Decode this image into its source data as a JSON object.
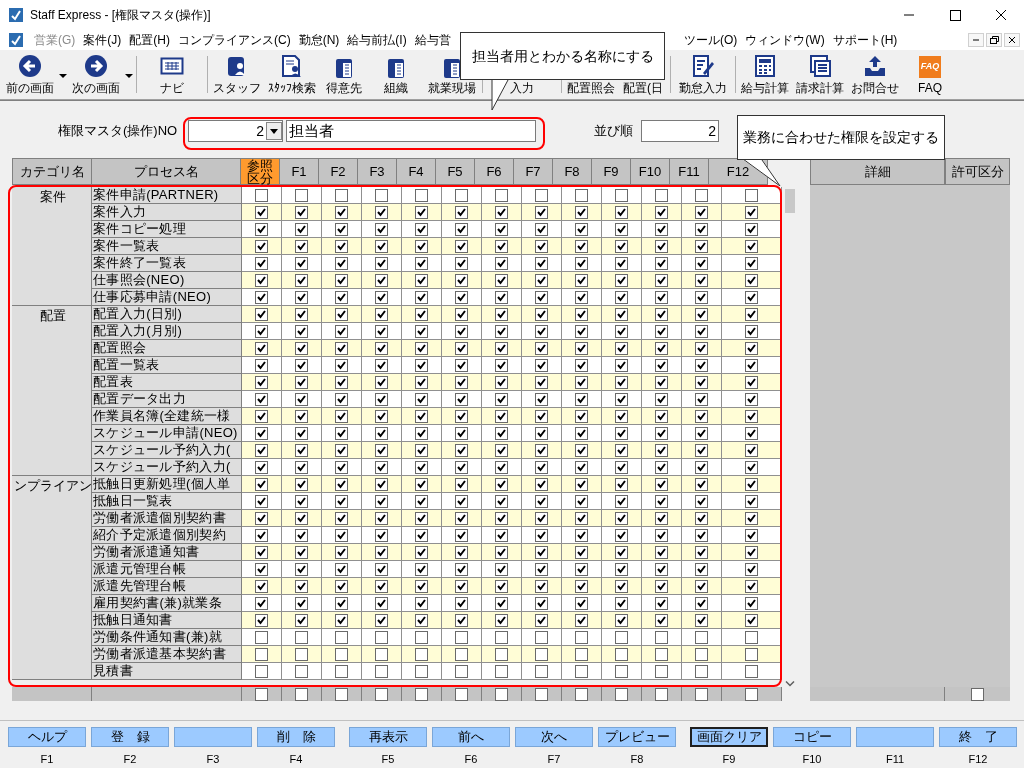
{
  "window": {
    "title": "Staff Express - [権限マスタ(操作)]"
  },
  "menu": [
    {
      "label": "営業(G)",
      "disabled": true
    },
    {
      "label": "案件(J)",
      "disabled": false
    },
    {
      "label": "配置(H)",
      "disabled": false
    },
    {
      "label": "コンプライアンス(C)",
      "disabled": false
    },
    {
      "label": "勤怠(N)",
      "disabled": false
    },
    {
      "label": "給与前払(I)",
      "disabled": false
    },
    {
      "label": "給与営",
      "disabled": false
    },
    {
      "label": "ツール(O)",
      "disabled": false
    },
    {
      "label": "ウィンドウ(W)",
      "disabled": false
    },
    {
      "label": "サポート(H)",
      "disabled": false
    }
  ],
  "toolbar": [
    {
      "label": "前の画面",
      "kind": "back",
      "dropdown": true
    },
    {
      "label": "次の画面",
      "kind": "forward",
      "dropdown": true
    },
    {
      "label": "ナビ",
      "kind": "keyboard",
      "dropdown": false
    },
    {
      "label": "スタッフ",
      "kind": "person",
      "dropdown": false
    },
    {
      "label": "ｽﾀｯﾌ検索",
      "kind": "search",
      "dropdown": false
    },
    {
      "label": "得意先",
      "kind": "building",
      "dropdown": false
    },
    {
      "label": "組織",
      "kind": "building",
      "dropdown": false
    },
    {
      "label": "就業現場",
      "kind": "building",
      "dropdown": false
    },
    {
      "label": "入力",
      "kind": "plain",
      "dropdown": false
    },
    {
      "label": "配置照会",
      "kind": "plain",
      "dropdown": false
    },
    {
      "label": "配置(日",
      "kind": "plain",
      "dropdown": false
    },
    {
      "label": "勤怠入力",
      "kind": "edit",
      "dropdown": false
    },
    {
      "label": "給与計算",
      "kind": "calc",
      "dropdown": false
    },
    {
      "label": "請求計算",
      "kind": "sheet",
      "dropdown": false
    },
    {
      "label": "お問合せ",
      "kind": "tray",
      "dropdown": false
    },
    {
      "label": "FAQ",
      "kind": "faq",
      "badge": "FAQ",
      "dropdown": false
    }
  ],
  "callouts": [
    {
      "text": "担当者用とわかる名称にする"
    },
    {
      "text": "業務に合わせた権限を設定する"
    }
  ],
  "form": {
    "no_label": "権限マスタ(操作)NO",
    "no_value": "2",
    "name_value": "担当者",
    "order_label": "並び順",
    "order_value": "2"
  },
  "table": {
    "columns": [
      {
        "label": "カテゴリ名",
        "highlighted": false
      },
      {
        "label": "プロセス名",
        "highlighted": false
      },
      {
        "label": "参照区分",
        "highlighted": true
      },
      {
        "label": "F1",
        "highlighted": false
      },
      {
        "label": "F2",
        "highlighted": false
      },
      {
        "label": "F3",
        "highlighted": false
      },
      {
        "label": "F4",
        "highlighted": false
      },
      {
        "label": "F5",
        "highlighted": false
      },
      {
        "label": "F6",
        "highlighted": false
      },
      {
        "label": "F7",
        "highlighted": false
      },
      {
        "label": "F8",
        "highlighted": false
      },
      {
        "label": "F9",
        "highlighted": false
      },
      {
        "label": "F10",
        "highlighted": false
      },
      {
        "label": "F11",
        "highlighted": false
      },
      {
        "label": "F12",
        "highlighted": false
      }
    ],
    "categories": [
      {
        "name": "案件",
        "processes": [
          {
            "name": "案件申請(PARTNER)",
            "checks": [
              false,
              false,
              false,
              false,
              false,
              false,
              false,
              false,
              false,
              false,
              false,
              false,
              false
            ]
          },
          {
            "name": "案件入力",
            "checks": [
              true,
              true,
              true,
              true,
              true,
              true,
              true,
              true,
              true,
              true,
              true,
              true,
              true
            ]
          },
          {
            "name": "案件コピー処理",
            "checks": [
              true,
              true,
              true,
              true,
              true,
              true,
              true,
              true,
              true,
              true,
              true,
              true,
              true
            ]
          },
          {
            "name": "案件一覧表",
            "checks": [
              true,
              true,
              true,
              true,
              true,
              true,
              true,
              true,
              true,
              true,
              true,
              true,
              true
            ]
          },
          {
            "name": "案件終了一覧表",
            "checks": [
              true,
              true,
              true,
              true,
              true,
              true,
              true,
              true,
              true,
              true,
              true,
              true,
              true
            ]
          },
          {
            "name": "仕事照会(NEO)",
            "checks": [
              true,
              true,
              true,
              true,
              true,
              true,
              true,
              true,
              true,
              true,
              true,
              true,
              true
            ]
          },
          {
            "name": "仕事応募申請(NEO)",
            "checks": [
              true,
              true,
              true,
              true,
              true,
              true,
              true,
              true,
              true,
              true,
              true,
              true,
              true
            ]
          }
        ]
      },
      {
        "name": "配置",
        "processes": [
          {
            "name": "配置入力(日別)",
            "checks": [
              true,
              true,
              true,
              true,
              true,
              true,
              true,
              true,
              true,
              true,
              true,
              true,
              true
            ]
          },
          {
            "name": "配置入力(月別)",
            "checks": [
              true,
              true,
              true,
              true,
              true,
              true,
              true,
              true,
              true,
              true,
              true,
              true,
              true
            ]
          },
          {
            "name": "配置照会",
            "checks": [
              true,
              true,
              true,
              true,
              true,
              true,
              true,
              true,
              true,
              true,
              true,
              true,
              true
            ]
          },
          {
            "name": "配置一覧表",
            "checks": [
              true,
              true,
              true,
              true,
              true,
              true,
              true,
              true,
              true,
              true,
              true,
              true,
              true
            ]
          },
          {
            "name": "配置表",
            "checks": [
              true,
              true,
              true,
              true,
              true,
              true,
              true,
              true,
              true,
              true,
              true,
              true,
              true
            ]
          },
          {
            "name": "配置データ出力",
            "checks": [
              true,
              true,
              true,
              true,
              true,
              true,
              true,
              true,
              true,
              true,
              true,
              true,
              true
            ]
          },
          {
            "name": "作業員名簿(全建統一様",
            "checks": [
              true,
              true,
              true,
              true,
              true,
              true,
              true,
              true,
              true,
              true,
              true,
              true,
              true
            ]
          },
          {
            "name": "スケジュール申請(NEO)",
            "checks": [
              true,
              true,
              true,
              true,
              true,
              true,
              true,
              true,
              true,
              true,
              true,
              true,
              true
            ]
          },
          {
            "name": "スケジュール予約入力(",
            "checks": [
              true,
              true,
              true,
              true,
              true,
              true,
              true,
              true,
              true,
              true,
              true,
              true,
              true
            ]
          },
          {
            "name": "スケジュール予約入力(",
            "checks": [
              true,
              true,
              true,
              true,
              true,
              true,
              true,
              true,
              true,
              true,
              true,
              true,
              true
            ]
          }
        ]
      },
      {
        "name": "ンプライアン",
        "processes": [
          {
            "name": "抵触日更新処理(個人単",
            "checks": [
              true,
              true,
              true,
              true,
              true,
              true,
              true,
              true,
              true,
              true,
              true,
              true,
              true
            ]
          },
          {
            "name": "抵触日一覧表",
            "checks": [
              true,
              true,
              true,
              true,
              true,
              true,
              true,
              true,
              true,
              true,
              true,
              true,
              true
            ]
          },
          {
            "name": "労働者派遣個別契約書",
            "checks": [
              true,
              true,
              true,
              true,
              true,
              true,
              true,
              true,
              true,
              true,
              true,
              true,
              true
            ]
          },
          {
            "name": "紹介予定派遣個別契約",
            "checks": [
              true,
              true,
              true,
              true,
              true,
              true,
              true,
              true,
              true,
              true,
              true,
              true,
              true
            ]
          },
          {
            "name": "労働者派遣通知書",
            "checks": [
              true,
              true,
              true,
              true,
              true,
              true,
              true,
              true,
              true,
              true,
              true,
              true,
              true
            ]
          },
          {
            "name": "派遣元管理台帳",
            "checks": [
              true,
              true,
              true,
              true,
              true,
              true,
              true,
              true,
              true,
              true,
              true,
              true,
              true
            ]
          },
          {
            "name": "派遣先管理台帳",
            "checks": [
              true,
              true,
              true,
              true,
              true,
              true,
              true,
              true,
              true,
              true,
              true,
              true,
              true
            ]
          },
          {
            "name": "雇用契約書(兼)就業条",
            "checks": [
              true,
              true,
              true,
              true,
              true,
              true,
              true,
              true,
              true,
              true,
              true,
              true,
              true
            ]
          },
          {
            "name": "抵触日通知書",
            "checks": [
              true,
              true,
              true,
              true,
              true,
              true,
              true,
              true,
              true,
              true,
              true,
              true,
              true
            ]
          },
          {
            "name": "労働条件通知書(兼)就",
            "checks": [
              false,
              false,
              false,
              false,
              false,
              false,
              false,
              false,
              false,
              false,
              false,
              false,
              false
            ]
          },
          {
            "name": "労働者派遣基本契約書",
            "checks": [
              false,
              false,
              false,
              false,
              false,
              false,
              false,
              false,
              false,
              false,
              false,
              false,
              false
            ]
          },
          {
            "name": "見積書",
            "checks": [
              false,
              false,
              false,
              false,
              false,
              false,
              false,
              false,
              false,
              false,
              false,
              false,
              false
            ]
          }
        ]
      }
    ],
    "footer_checks": [
      false,
      false,
      false,
      false,
      false,
      false,
      false,
      false,
      false,
      false,
      false,
      false,
      false
    ]
  },
  "detail_panel": {
    "columns": [
      "詳細",
      "許可区分"
    ],
    "footer_check": false
  },
  "function_keys": [
    {
      "label": "ヘルプ",
      "key": "F1",
      "selected": false
    },
    {
      "label": "登　録",
      "key": "F2",
      "selected": false
    },
    {
      "key": "F3",
      "selected": false
    },
    {
      "label": "削　除",
      "key": "F4",
      "selected": false
    },
    {
      "label": "再表示",
      "key": "F5",
      "selected": false
    },
    {
      "label": "前へ",
      "key": "F6",
      "selected": false
    },
    {
      "label": "次へ",
      "key": "F7",
      "selected": false
    },
    {
      "label": "プレビュー",
      "key": "F8",
      "selected": false
    },
    {
      "label": "画面クリア",
      "key": "F9",
      "selected": true
    },
    {
      "label": "コピー",
      "key": "F10",
      "selected": false
    },
    {
      "key": "F11",
      "selected": false
    },
    {
      "label": "終　了",
      "key": "F12",
      "selected": false
    }
  ]
}
